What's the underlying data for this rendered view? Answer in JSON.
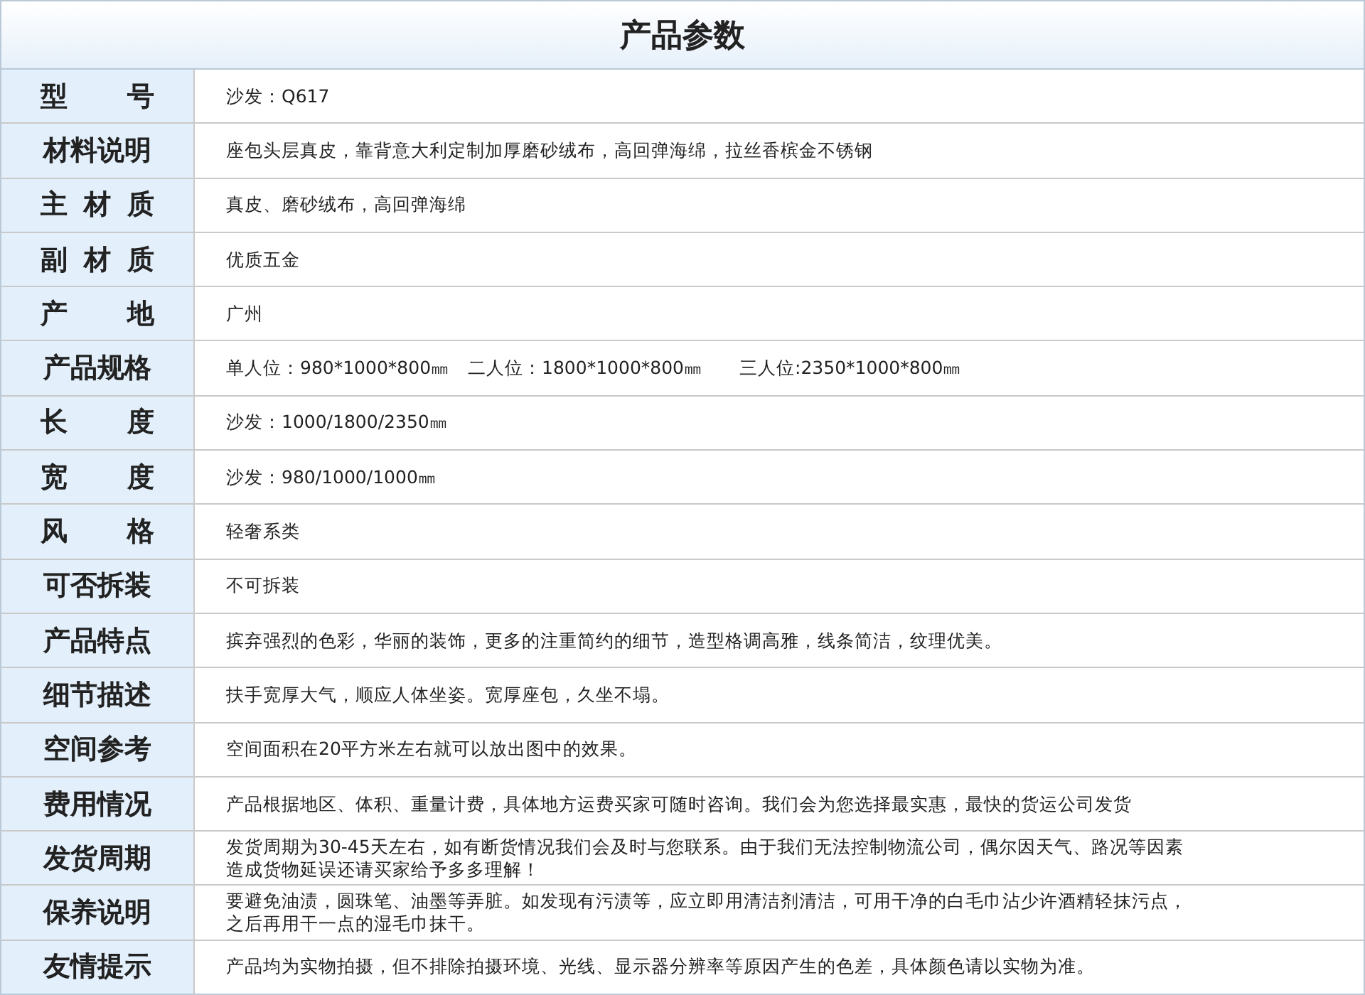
{
  "title": "产品参数",
  "rows": [
    {
      "label": "型号",
      "value": "沙发：Q617"
    },
    {
      "label": "材料说明",
      "value": "座包头层真皮，靠背意大利定制加厚磨砂绒布，高回弹海绵，拉丝香槟金不锈钢"
    },
    {
      "label": "主材质",
      "value": "真皮、磨砂绒布，高回弹海绵"
    },
    {
      "label": "副材质",
      "value": "优质五金"
    },
    {
      "label": "产地",
      "value": "广州"
    },
    {
      "label": "产品规格",
      "value": "单人位：980*1000*800㎜　二人位：1800*1000*800㎜　　三人位:2350*1000*800㎜"
    },
    {
      "label": "长度",
      "value": "沙发：1000/1800/2350㎜"
    },
    {
      "label": "宽度",
      "value": "沙发：980/1000/1000㎜"
    },
    {
      "label": "风格",
      "value": "轻奢系类"
    },
    {
      "label": "可否拆装",
      "value": "不可拆装"
    },
    {
      "label": "产品特点",
      "value": "摈弃强烈的色彩，华丽的装饰，更多的注重简约的细节，造型格调高雅，线条简洁，纹理优美。"
    },
    {
      "label": "细节描述",
      "value": "扶手宽厚大气，顺应人体坐姿。宽厚座包，久坐不塌。"
    },
    {
      "label": "空间参考",
      "value": "空间面积在20平方米左右就可以放出图中的效果。"
    },
    {
      "label": "费用情况",
      "value": "产品根据地区、体积、重量计费，具体地方运费买家可随时咨询。我们会为您选择最实惠，最快的货运公司发货"
    },
    {
      "label": "发货周期",
      "lines": [
        "发货周期为30-45天左右，如有断货情况我们会及时与您联系。由于我们无法控制物流公司，偶尔因天气、路况等因素",
        "造成货物延误还请买家给予多多理解！"
      ]
    },
    {
      "label": "保养说明",
      "lines": [
        "要避免油渍，圆珠笔、油墨等弄脏。如发现有污渍等，应立即用清洁剂清洁，可用干净的白毛巾沾少许酒精轻抹污点，",
        "之后再用干一点的湿毛巾抹干。"
      ]
    },
    {
      "label": "友情提示",
      "value": "产品均为实物拍摄，但不排除拍摄环境、光线、显示器分辨率等原因产生的色差，具体颜色请以实物为准。"
    }
  ]
}
